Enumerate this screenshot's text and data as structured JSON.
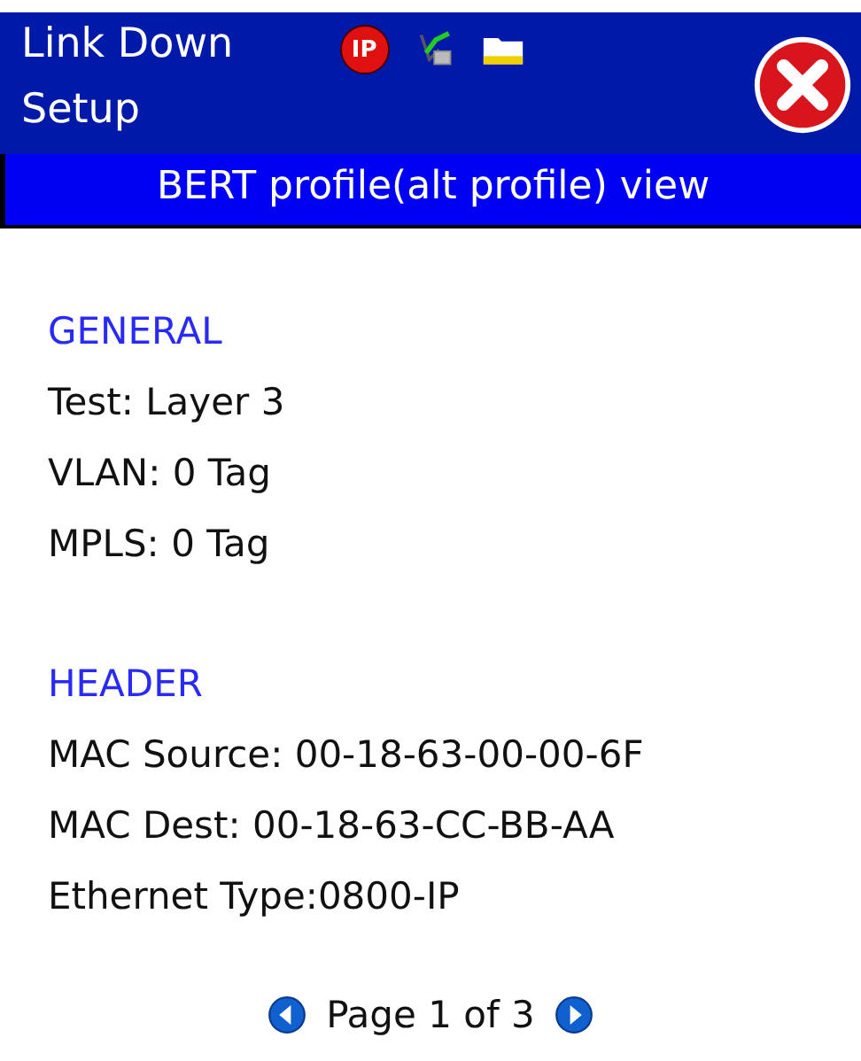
{
  "header": {
    "status": "Link Down",
    "mode": "Setup",
    "ip_badge": "IP"
  },
  "title_bar": "BERT profile(alt profile) view",
  "sections": [
    {
      "heading": "GENERAL",
      "lines": [
        "Test: Layer 3",
        "VLAN: 0 Tag",
        "MPLS: 0 Tag"
      ]
    },
    {
      "heading": "HEADER",
      "lines": [
        "MAC Source: 00-18-63-00-00-6F",
        "MAC Dest: 00-18-63-CC-BB-AA",
        "Ethernet Type:0800-IP"
      ]
    }
  ],
  "pager": "Page 1 of 3"
}
